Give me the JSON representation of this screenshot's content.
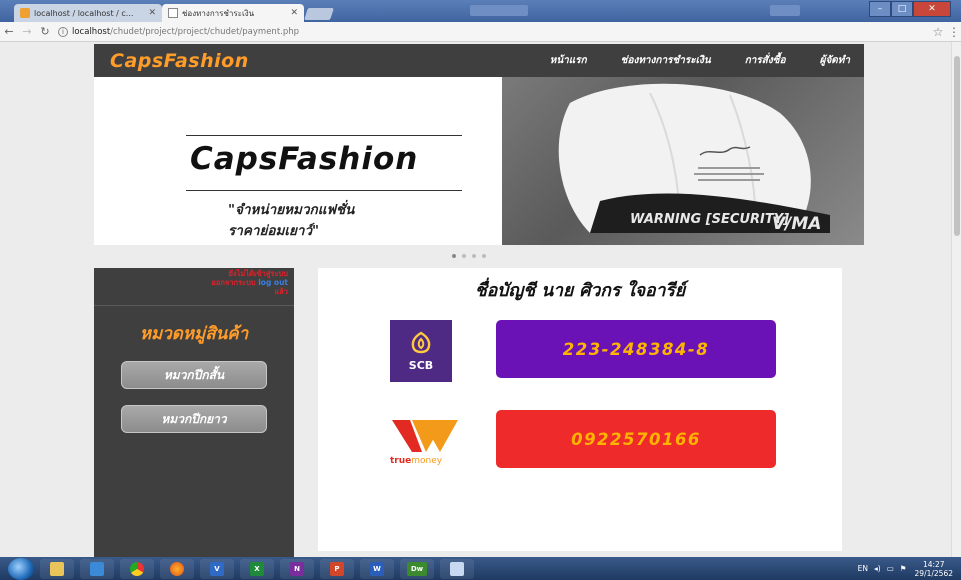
{
  "browser": {
    "tabs": [
      {
        "title": "localhost / localhost / c...",
        "active": false
      },
      {
        "title": "ช่องทางการชำระเงิน",
        "active": true
      }
    ],
    "url_host": "localhost",
    "url_path": "/chudet/project/project/chudet/payment.php"
  },
  "navbar": {
    "brand": "CapsFashion",
    "menu": [
      "หน้าแรก",
      "ช่องทางการชำระเงิน",
      "การสั่งซื้อ",
      "ผู้จัดทำ"
    ]
  },
  "banner": {
    "title": "CapsFashion",
    "subtitle_1": "\"จำหน่ายหมวกแฟชั่น",
    "subtitle_2": "ราคาย่อมเยาว์\"",
    "cap_text_1": "WARNING [SECURITY]",
    "cap_text_2": "V/MA"
  },
  "sidebar": {
    "warning_1": "ยังไม่ได้เข้าสู่ระบบ",
    "warning_2": "ออกจากระบบ",
    "warning_link": "log out",
    "warning_3": "แล้ว",
    "heading": "หมวดหมู่สินค้า",
    "buttons": [
      "หมวกปีกสั้น",
      "หมวกปีกยาว"
    ]
  },
  "payment": {
    "account_name": "ชื่อบัญชี นาย ศิวกร ใจอารีย์",
    "scb_label": "SCB",
    "scb_number": "223-248384-8",
    "tm_label_1": "true",
    "tm_label_2": "money",
    "tm_number": "0922570166"
  },
  "taskbar": {
    "apps": [
      "V",
      "X",
      "N",
      "P",
      "W",
      "Dw"
    ],
    "lang": "EN",
    "time": "14:27",
    "date": "29/1/2562"
  },
  "colors": {
    "brand_orange": "#ff9c2a",
    "navbar_bg": "#3f3f3f",
    "scb_purple": "#6a12b6",
    "truemoney_red": "#ee2a2a",
    "number_text": "#ffb400"
  }
}
